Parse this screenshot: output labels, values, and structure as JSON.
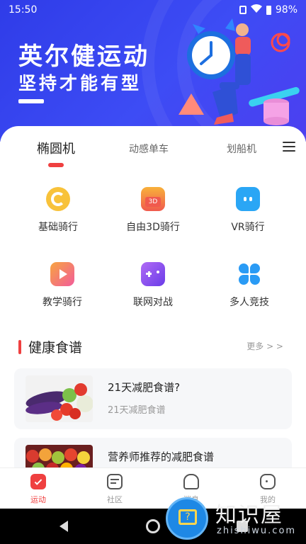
{
  "status": {
    "time": "15:50",
    "battery": "98%"
  },
  "hero": {
    "title": "英尔健运动",
    "subtitle": "坚持才能有型"
  },
  "tabs": [
    {
      "label": "椭圆机",
      "active": true
    },
    {
      "label": "动感单车",
      "active": false
    },
    {
      "label": "划船机",
      "active": false
    }
  ],
  "modes": [
    {
      "label": "基础骑行",
      "icon": "ring-icon",
      "color": "#f6b21e"
    },
    {
      "label": "自由3D骑行",
      "icon": "3d-icon",
      "color": "#f05a4e"
    },
    {
      "label": "VR骑行",
      "icon": "vr-icon",
      "color": "#2aa6f5"
    },
    {
      "label": "教学骑行",
      "icon": "play-icon",
      "color": "#f25c9a"
    },
    {
      "label": "联网对战",
      "icon": "gamepad-icon",
      "color": "#8a4ff0"
    },
    {
      "label": "多人竞技",
      "icon": "clover-icon",
      "color": "#2a9bf5"
    }
  ],
  "section": {
    "title": "健康食谱",
    "more": "更多 > >"
  },
  "recipes": [
    {
      "title": "21天减肥食谱?",
      "subtitle": "21天减肥食谱"
    },
    {
      "title": "营养师推荐的减肥食谱",
      "subtitle": ""
    }
  ],
  "nav": [
    {
      "label": "运动",
      "icon": "sport-icon",
      "active": true
    },
    {
      "label": "社区",
      "icon": "community-icon",
      "active": false
    },
    {
      "label": "消息",
      "icon": "bell-icon",
      "active": false
    },
    {
      "label": "我的",
      "icon": "profile-icon",
      "active": false
    }
  ],
  "watermark": {
    "brand": "知识屋",
    "domain": "zhishiwu.com"
  }
}
